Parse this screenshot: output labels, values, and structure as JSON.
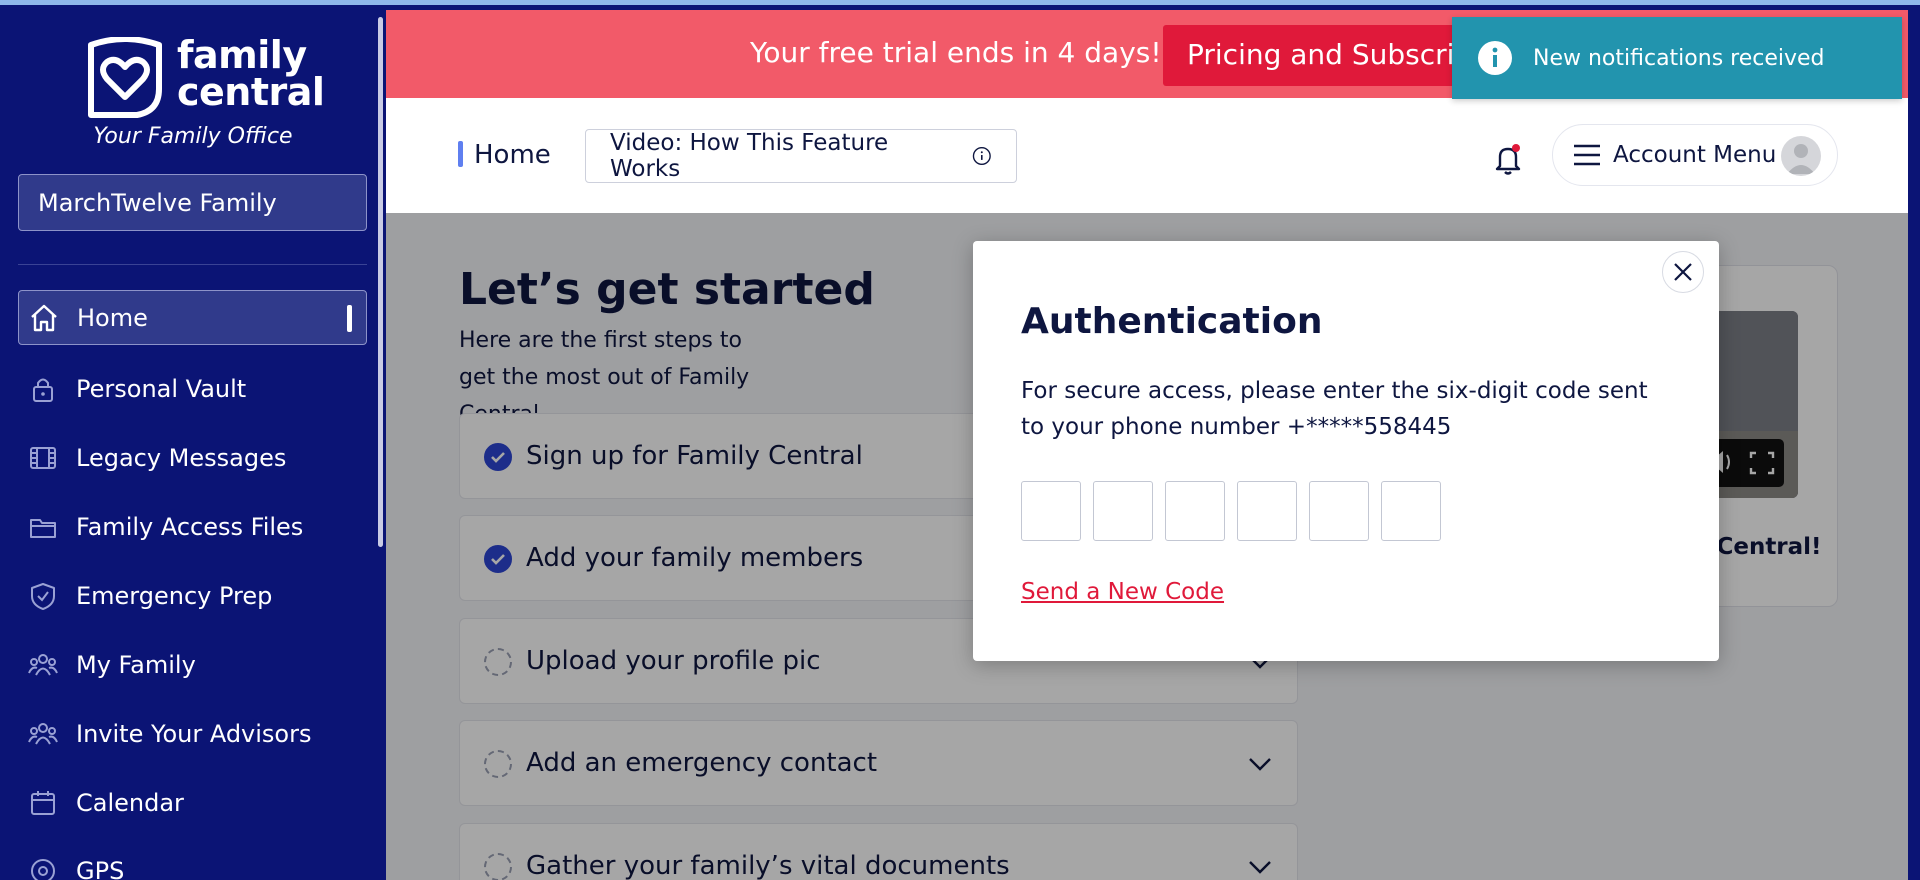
{
  "brand": {
    "name_line1": "family",
    "name_line2": "central",
    "tagline": "Your Family Office"
  },
  "family_selector": {
    "value": "MarchTwelve Family"
  },
  "sidebar": {
    "items": [
      {
        "label": "Home",
        "icon": "home-icon",
        "active": true
      },
      {
        "label": "Personal Vault",
        "icon": "lock-icon"
      },
      {
        "label": "Legacy Messages",
        "icon": "film-icon"
      },
      {
        "label": "Family Access Files",
        "icon": "folder-icon"
      },
      {
        "label": "Emergency Prep",
        "icon": "shield-check-icon"
      },
      {
        "label": "My Family",
        "icon": "people-icon"
      },
      {
        "label": "Invite Your Advisors",
        "icon": "people-icon"
      },
      {
        "label": "Calendar",
        "icon": "calendar-icon"
      },
      {
        "label": "GPS",
        "icon": "location-pin-icon"
      }
    ]
  },
  "banner": {
    "text": "Your free trial ends in 4 days!",
    "button_label": "Pricing and Subscriptions"
  },
  "header": {
    "breadcrumb": "Home",
    "video_button": "Video: How This Feature Works",
    "account_menu": "Account Menu"
  },
  "content": {
    "title": "Let’s get started",
    "subtitle": "Here are the first steps to get the most out of Family Central",
    "tasks": [
      {
        "label": "Sign up for Family Central",
        "done": true
      },
      {
        "label": "Add your family members",
        "done": true
      },
      {
        "label": "Upload your profile pic",
        "done": false
      },
      {
        "label": "Add an emergency contact",
        "done": false
      },
      {
        "label": "Gather your family’s vital documents",
        "done": false
      }
    ]
  },
  "video_card": {
    "title": "Welcome to Family Central!"
  },
  "modal": {
    "title": "Authentication",
    "body": "For secure access, please enter the six-digit code sent to your phone number +*****558445",
    "code_length": 6,
    "resend_link": "Send a New Code"
  },
  "toast": {
    "text": "New notifications received",
    "color": "#2294ae"
  },
  "colors": {
    "sidebar": "#0b1475",
    "banner": "#f25a69",
    "accent_red": "#e0193a",
    "check_blue": "#2d46d4"
  }
}
